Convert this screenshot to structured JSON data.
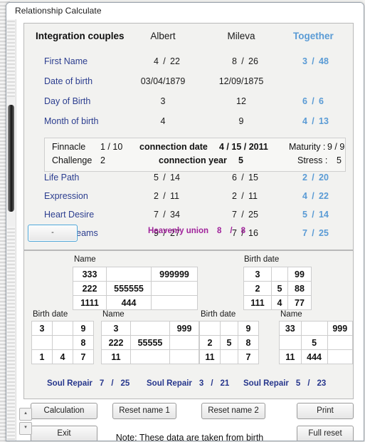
{
  "window": {
    "title": "Relationship Calculate"
  },
  "header": {
    "section_title": "Integration couples",
    "person1": "Albert",
    "person2": "Mileva",
    "together": "Together"
  },
  "rows": [
    {
      "label": "First Name",
      "p1_n": "4",
      "p1_m": "22",
      "p2_n": "8",
      "p2_m": "26",
      "t_n": "3",
      "t_m": "48"
    },
    {
      "label": "Date of birth",
      "p1_date": "03/04/1879",
      "p2_date": "12/09/1875",
      "t_n": "",
      "t_m": ""
    },
    {
      "label": "Day of Birth",
      "p1_n": "3",
      "p1_m": "",
      "p2_n": "12",
      "p2_m": "",
      "t_n": "6",
      "t_m": "6"
    },
    {
      "label": "Month of birth",
      "p1_n": "4",
      "p1_m": "",
      "p2_n": "9",
      "p2_m": "",
      "t_n": "4",
      "t_m": "13"
    }
  ],
  "pinnacle": {
    "finnacle_label": "Finnacle",
    "finnacle_value": "1 / 10",
    "challenge_label": "Challenge",
    "challenge_value": "2",
    "connection_date_label": "connection date",
    "connection_date_value": "4  /  15 / 2011",
    "connection_year_label": "connection year",
    "connection_year_value": "5",
    "maturity_label": "Maturity :",
    "maturity_value": "9 / 9",
    "stress_label": "Stress :",
    "stress_value": "5"
  },
  "rows2": [
    {
      "label": "Life Path",
      "p1_n": "5",
      "p1_m": "14",
      "p2_n": "6",
      "p2_m": "15",
      "t_n": "2",
      "t_m": "20"
    },
    {
      "label": "Expression",
      "p1_n": "2",
      "p1_m": "11",
      "p2_n": "2",
      "p2_m": "11",
      "t_n": "4",
      "t_m": "22"
    },
    {
      "label": "Heart Desire",
      "p1_n": "7",
      "p1_m": "34",
      "p2_n": "7",
      "p2_m": "25",
      "t_n": "5",
      "t_m": "14"
    },
    {
      "label": "Inner Dreams",
      "p1_n": "9",
      "p1_m": "27",
      "p2_n": "7",
      "p2_m": "16",
      "t_n": "7",
      "t_m": "25"
    }
  ],
  "minus_button": "-",
  "heavenly": {
    "label": "Heavenly union",
    "n": "8",
    "sep": "/",
    "m": "8"
  },
  "grids": [
    {
      "caption": "Name",
      "cells": [
        [
          "333",
          "",
          "999999"
        ],
        [
          "222",
          "555555",
          ""
        ],
        [
          "1111",
          "444",
          ""
        ]
      ]
    },
    {
      "caption": "Birth date",
      "cells": [
        [
          "3",
          "",
          "99"
        ],
        [
          "2",
          "5",
          "88"
        ],
        [
          "111",
          "4",
          "77"
        ]
      ]
    },
    {
      "caption": "Birth date",
      "cells": [
        [
          "3",
          "",
          "9"
        ],
        [
          "",
          "",
          "8"
        ],
        [
          "1",
          "4",
          "7"
        ]
      ]
    },
    {
      "caption": "Name",
      "cells": [
        [
          "3",
          "",
          "999"
        ],
        [
          "222",
          "55555",
          ""
        ],
        [
          "11",
          "",
          ""
        ]
      ]
    },
    {
      "caption": "Birth date",
      "cells": [
        [
          "",
          "",
          "9"
        ],
        [
          "2",
          "5",
          "8"
        ],
        [
          "11",
          "",
          "7"
        ]
      ]
    },
    {
      "caption": "Name",
      "cells": [
        [
          "33",
          "",
          "999"
        ],
        [
          "",
          "5",
          ""
        ],
        [
          "11",
          "444",
          ""
        ]
      ]
    }
  ],
  "soul_repair": [
    {
      "label": "Soul Repair",
      "n": "7",
      "sep": "/",
      "m": "25"
    },
    {
      "label": "Soul Repair",
      "n": "3",
      "sep": "/",
      "m": "21"
    },
    {
      "label": "Soul Repair",
      "n": "5",
      "sep": "/",
      "m": "23"
    }
  ],
  "buttons": {
    "calculation": "Calculation",
    "reset_name_1": "Reset name 1",
    "reset_name_2": "Reset name 2",
    "print": "Print",
    "exit": "Exit",
    "full_reset": "Full reset"
  },
  "note": "Note: These data are taken from birth",
  "spinner": {
    "up": "▴",
    "down": "▾"
  },
  "colors": {
    "label_navy": "#26368c",
    "together_blue": "#5a9bd5",
    "red": "#d01818",
    "purple": "#a0229b"
  }
}
